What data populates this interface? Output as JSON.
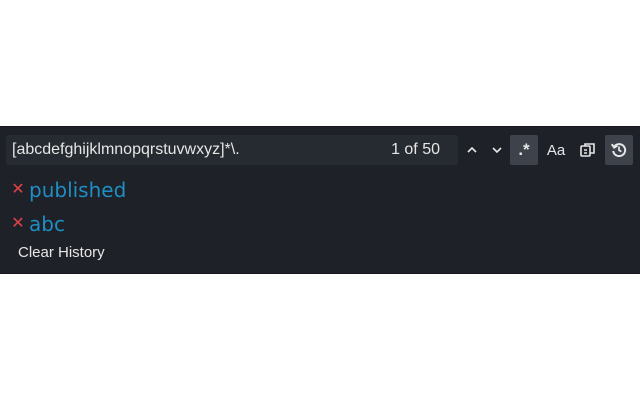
{
  "search": {
    "query": "[abcdefghijklmnopqrstuvwxyz]*\\.",
    "match_count": "1 of 50"
  },
  "toolbar": {
    "prev_icon": "chevron-up-icon",
    "next_icon": "chevron-down-icon",
    "regex_label": ".*",
    "case_label": "Aa",
    "regex_active": true,
    "history_active": true
  },
  "history": {
    "items": [
      {
        "text": "published"
      },
      {
        "text": "abc"
      }
    ],
    "clear_label": "Clear History"
  },
  "colors": {
    "panel_bg": "#1e2127",
    "history_text": "#1f8ec2",
    "remove_x": "#e0434b"
  }
}
